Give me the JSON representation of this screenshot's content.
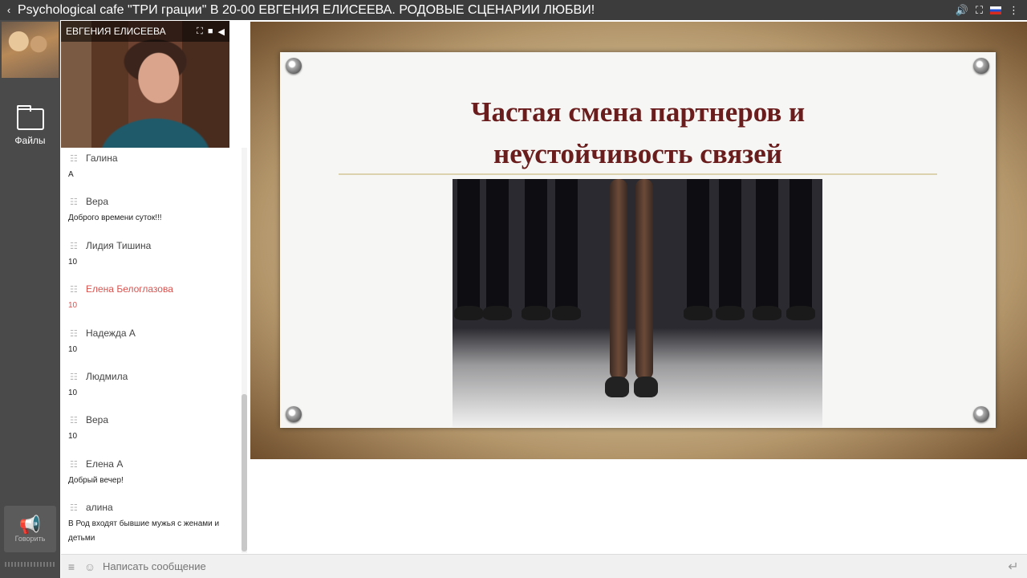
{
  "window": {
    "title": "Psychological cafe \"ТРИ грации\" В 20-00 ЕВГЕНИЯ ЕЛИСЕЕВА. РОДОВЫЕ СЦЕНАРИИ ЛЮБВИ!",
    "share_icon": "share-icon",
    "right_icons": [
      "volume-icon",
      "fullscreen-icon",
      "flag-ru-icon",
      "menu-dots-icon"
    ]
  },
  "sidebar": {
    "files_label": "Файлы",
    "speak_label": "Говорить"
  },
  "video": {
    "presenter_name": "ЕВГЕНИЯ ЕЛИСЕЕВА"
  },
  "chat": {
    "messages": [
      {
        "author": "Галина",
        "text": "А",
        "highlight": false
      },
      {
        "author": "Вера",
        "text": "Доброго времени суток!!!",
        "highlight": false
      },
      {
        "author": "Лидия Тишина",
        "text": "10",
        "highlight": false
      },
      {
        "author": "Елена Белоглазова",
        "text": "10",
        "highlight": true
      },
      {
        "author": "Надежда А",
        "text": "10",
        "highlight": false
      },
      {
        "author": "Людмила",
        "text": "10",
        "highlight": false
      },
      {
        "author": "Вера",
        "text": "10",
        "highlight": false
      },
      {
        "author": "Елена А",
        "text": "Добрый вечер!",
        "highlight": false
      },
      {
        "author": "алина",
        "text": "В Род входят бывшие мужья с женами и детьми",
        "highlight": false
      }
    ]
  },
  "slide": {
    "title_line1": "Частая смена партнеров и",
    "title_line2": "неустойчивость связей",
    "title_color": "#6a1d1d"
  },
  "input": {
    "placeholder": "Написать сообщение"
  },
  "colors": {
    "titlebar": "#3c3c3c",
    "rail": "#4a4a4a",
    "highlight_author": "#d9534f"
  }
}
